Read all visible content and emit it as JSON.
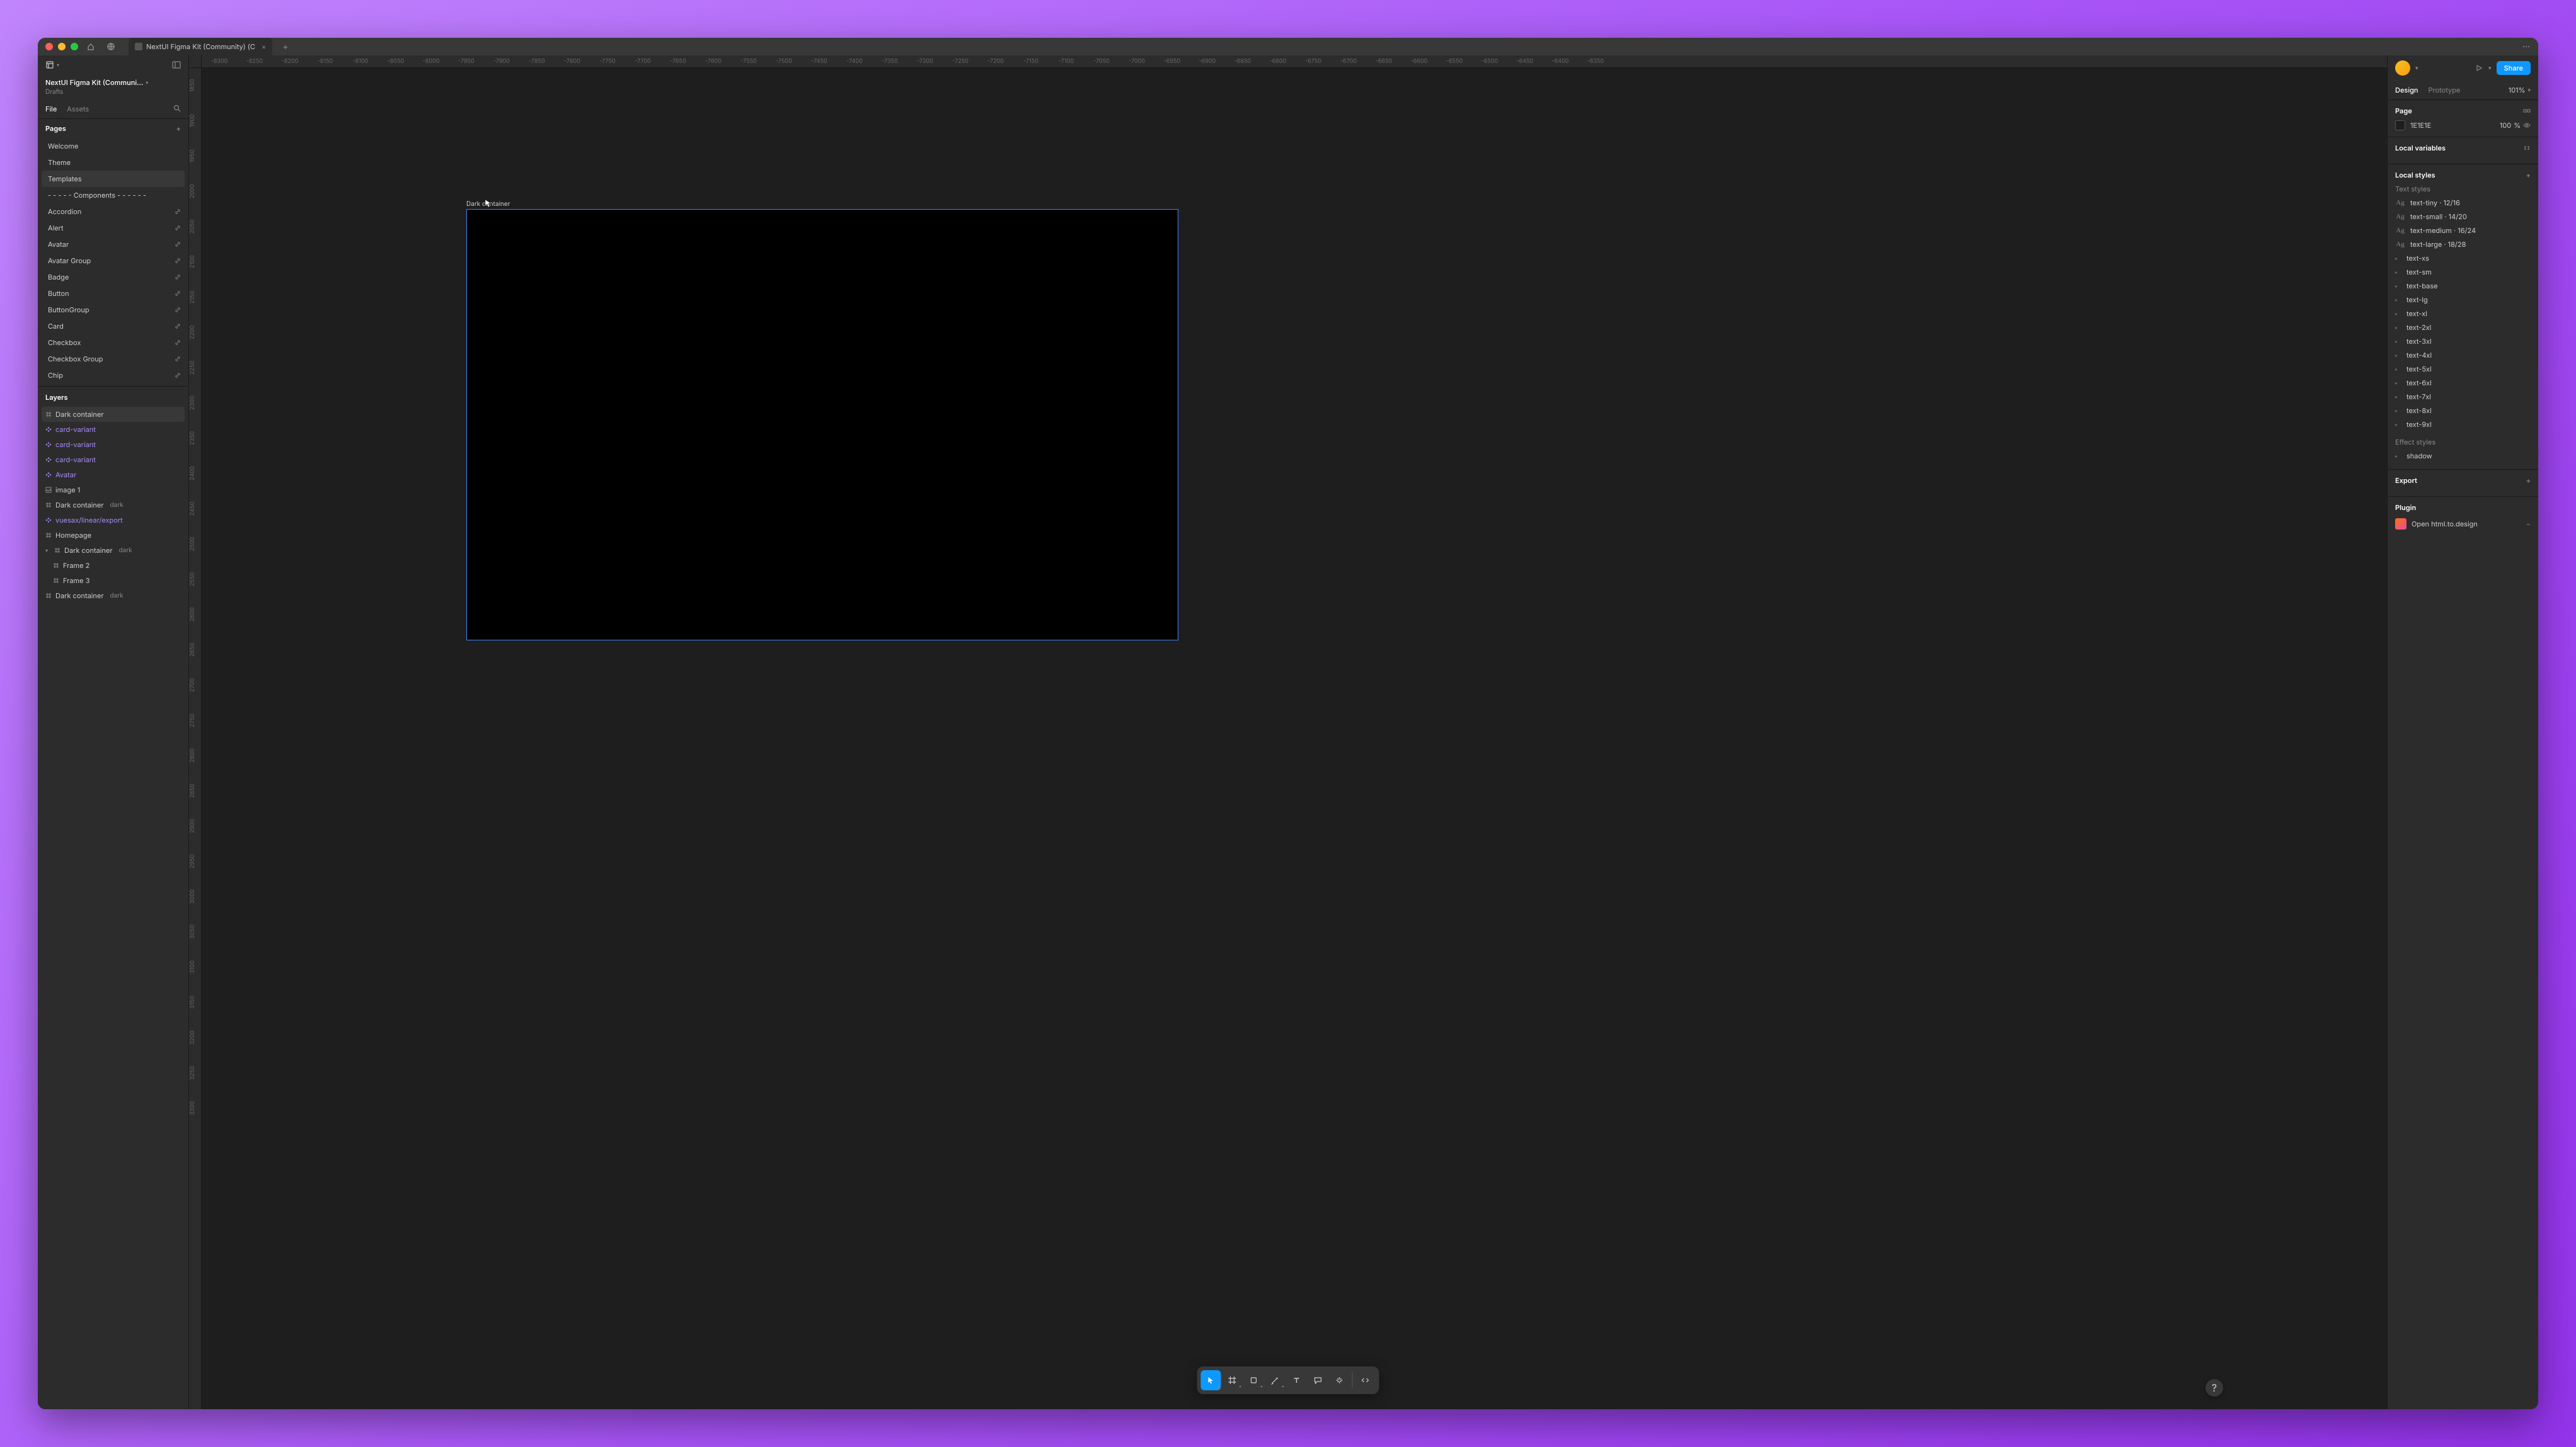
{
  "titlebar": {
    "tab_name": "NextUI Figma Kit (Community) (C"
  },
  "left_panel": {
    "file_name": "NextUI Figma Kit (Communi...",
    "file_location": "Drafts",
    "tabs": {
      "file": "File",
      "assets": "Assets"
    },
    "pages_header": "Pages",
    "pages": [
      {
        "name": "Welcome"
      },
      {
        "name": "Theme"
      },
      {
        "name": "Templates",
        "selected": true
      },
      {
        "name": "- - - - -  Components - - - - - -"
      },
      {
        "name": "Accordion",
        "linked": true
      },
      {
        "name": "Alert",
        "linked": true
      },
      {
        "name": "Avatar",
        "linked": true
      },
      {
        "name": "Avatar Group",
        "linked": true
      },
      {
        "name": "Badge",
        "linked": true
      },
      {
        "name": "Button",
        "linked": true
      },
      {
        "name": "ButtonGroup",
        "linked": true
      },
      {
        "name": "Card",
        "linked": true
      },
      {
        "name": "Checkbox",
        "linked": true
      },
      {
        "name": "Checkbox Group",
        "linked": true
      },
      {
        "name": "Chip",
        "linked": true
      }
    ],
    "layers_header": "Layers",
    "layers": [
      {
        "name": "Dark container",
        "icon": "frame",
        "selected": true,
        "indent": 0
      },
      {
        "name": "card-variant",
        "icon": "component",
        "variant": true,
        "indent": 0
      },
      {
        "name": "card-variant",
        "icon": "component",
        "variant": true,
        "indent": 0
      },
      {
        "name": "card-variant",
        "icon": "component",
        "variant": true,
        "indent": 0
      },
      {
        "name": "Avatar",
        "icon": "component",
        "variant": true,
        "indent": 0
      },
      {
        "name": "image 1",
        "icon": "image",
        "indent": 0
      },
      {
        "name": "Dark container",
        "tag": "dark",
        "icon": "frame",
        "indent": 0
      },
      {
        "name": "vuesax/linear/export",
        "icon": "component",
        "variant": true,
        "indent": 0
      },
      {
        "name": "Homepage",
        "icon": "frame",
        "indent": 0
      },
      {
        "name": "Dark container",
        "tag": "dark",
        "icon": "frame",
        "indent": 0,
        "expanded": true
      },
      {
        "name": "Frame 2",
        "icon": "frame",
        "indent": 1
      },
      {
        "name": "Frame 3",
        "icon": "frame",
        "indent": 1
      },
      {
        "name": "Dark container",
        "tag": "dark",
        "icon": "frame",
        "indent": 0
      }
    ]
  },
  "canvas": {
    "ruler_h": [
      "-8300",
      "-8250",
      "-8200",
      "-8150",
      "-8100",
      "-8050",
      "-8000",
      "-7950",
      "-7900",
      "-7850",
      "-7800",
      "-7750",
      "-7700",
      "-7650",
      "-7600",
      "-7550",
      "-7500",
      "-7450",
      "-7400",
      "-7350",
      "-7300",
      "-7250",
      "-7200",
      "-7150",
      "-7100",
      "-7050",
      "-7000",
      "-6950",
      "-6900",
      "-6850",
      "-6800",
      "-6750",
      "-6700",
      "-6650",
      "-6600",
      "-6550",
      "-6500",
      "-6450",
      "-6400",
      "-6350"
    ],
    "ruler_v": [
      "1850",
      "1900",
      "1950",
      "2000",
      "2050",
      "2100",
      "2150",
      "2200",
      "2250",
      "2300",
      "2350",
      "2400",
      "2450",
      "2500",
      "2550",
      "2600",
      "2650",
      "2700",
      "2750",
      "2800",
      "2850",
      "2900",
      "2950",
      "3000",
      "3050",
      "3100",
      "3150",
      "3200",
      "3250",
      "3300"
    ],
    "frame_label": "Dark container"
  },
  "right_panel": {
    "share": "Share",
    "tabs": {
      "design": "Design",
      "prototype": "Prototype"
    },
    "zoom": "101%",
    "page_header": "Page",
    "page_color": "1E1E1E",
    "page_opacity": "100",
    "page_opacity_unit": "%",
    "local_variables": "Local variables",
    "local_styles": "Local styles",
    "text_styles_header": "Text styles",
    "text_styles": [
      {
        "label": "text-tiny · 12/16",
        "ag": true
      },
      {
        "label": "text-small · 14/20",
        "ag": true
      },
      {
        "label": "text-medium · 16/24",
        "ag": true
      },
      {
        "label": "text-large · 18/28",
        "ag": true
      },
      {
        "label": "text-xs"
      },
      {
        "label": "text-sm"
      },
      {
        "label": "text-base"
      },
      {
        "label": "text-lg"
      },
      {
        "label": "text-xl"
      },
      {
        "label": "text-2xl"
      },
      {
        "label": "text-3xl"
      },
      {
        "label": "text-4xl"
      },
      {
        "label": "text-5xl"
      },
      {
        "label": "text-6xl"
      },
      {
        "label": "text-7xl"
      },
      {
        "label": "text-8xl"
      },
      {
        "label": "text-9xl"
      }
    ],
    "effect_styles_header": "Effect styles",
    "effect_styles": [
      {
        "label": "shadow"
      }
    ],
    "export_header": "Export",
    "plugin_header": "Plugin",
    "plugin_name": "Open html.to.design"
  },
  "help": "?"
}
